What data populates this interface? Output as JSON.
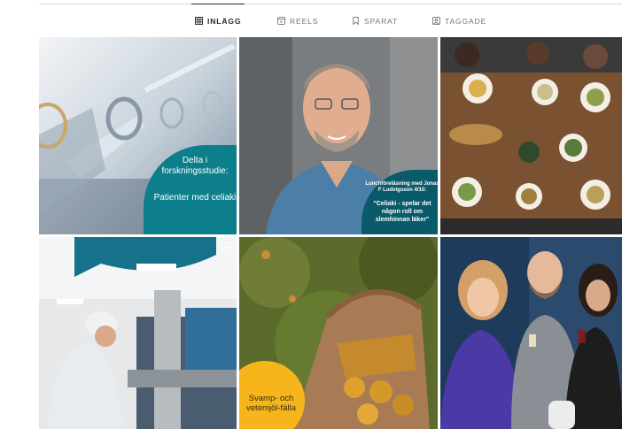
{
  "tabs": [
    {
      "label": "INLÄGG",
      "icon": "grid-icon",
      "active": true
    },
    {
      "label": "REELS",
      "icon": "reels-icon",
      "active": false
    },
    {
      "label": "SPARAT",
      "icon": "bookmark-icon",
      "active": false
    },
    {
      "label": "TAGGADE",
      "icon": "tagged-icon",
      "active": false
    }
  ],
  "posts": [
    {
      "lines": [
        "Delta i forskningsstudie:",
        "Patienter med celiaki"
      ],
      "color": "#0d7f8c"
    },
    {
      "lines": [
        "Lunchföreläsning med Jonas F Ludvigsson 4/10:",
        "\"Celiaki - spelar det någon roll om slemhinnan läker\""
      ],
      "color": "#0a5b6a"
    },
    {
      "lines": []
    },
    {
      "lines": [],
      "icon": "reel-play-icon"
    },
    {
      "lines": [
        "Svamp- och vetemjöl-fälla"
      ],
      "color": "#f5b51b"
    },
    {
      "lines": []
    }
  ]
}
